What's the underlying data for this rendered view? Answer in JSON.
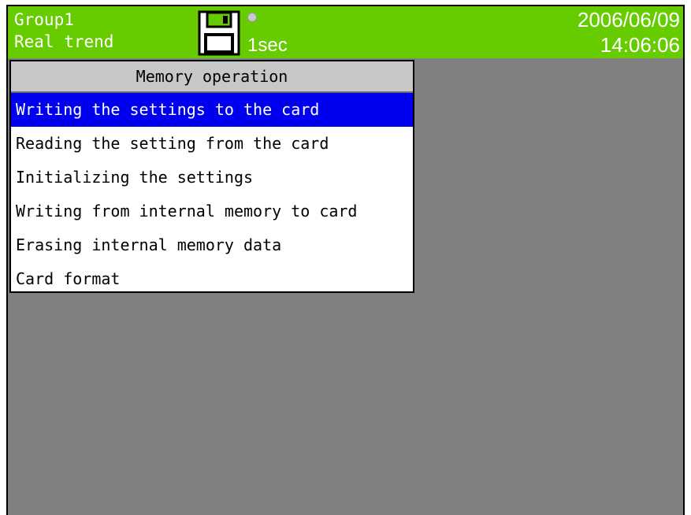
{
  "header": {
    "group": "Group1",
    "mode": "Real trend",
    "interval": "1sec",
    "date": "2006/06/09",
    "time": "14:06:06",
    "storage_icon": "floppy-disk-icon",
    "status_indicator": "status-dot-icon"
  },
  "menu": {
    "title": "Memory operation",
    "selected_index": 0,
    "items": [
      {
        "label": "Writing the settings to the card"
      },
      {
        "label": "Reading the setting from the card"
      },
      {
        "label": "Initializing the settings"
      },
      {
        "label": "Writing from internal memory to card"
      },
      {
        "label": "Erasing internal memory data"
      },
      {
        "label": "Card format"
      }
    ]
  },
  "colors": {
    "header_bg": "#66cc00",
    "screen_bg": "#808080",
    "selection_bg": "#0000ee",
    "menu_title_bg": "#c8c8c8"
  }
}
